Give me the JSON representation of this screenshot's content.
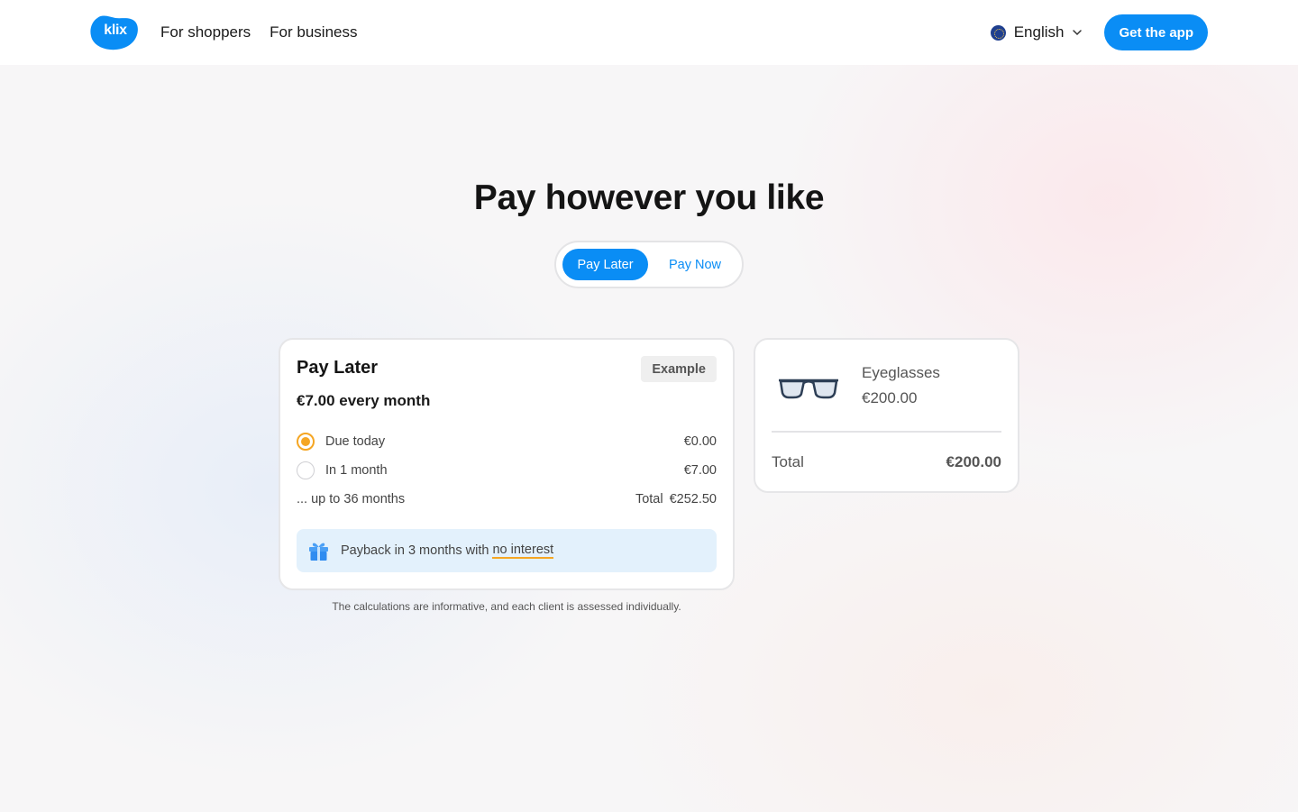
{
  "header": {
    "logo_text": "klix",
    "nav": [
      "For shoppers",
      "For business"
    ],
    "language": "English",
    "cta": "Get the app"
  },
  "main": {
    "title": "Pay however you like",
    "tabs": [
      "Pay Later",
      "Pay Now"
    ],
    "active_tab": "Pay Later"
  },
  "plan_card": {
    "title": "Pay Later",
    "badge": "Example",
    "monthly": "€7.00 every month",
    "schedule": [
      {
        "label": "Due today",
        "amount": "€0.00",
        "selected": true
      },
      {
        "label": "In 1 month",
        "amount": "€7.00",
        "selected": false
      }
    ],
    "upto_label": "... up to 36 months",
    "total_label": "Total",
    "total_value": "€252.50",
    "promo_text": "Payback in 3 months with ",
    "promo_highlight": "no interest",
    "disclaimer": "The calculations are informative, and each client is assessed individually."
  },
  "cart_card": {
    "product_name": "Eyeglasses",
    "product_price": "€200.00",
    "total_label": "Total",
    "total_value": "€200.00"
  },
  "colors": {
    "accent": "#0a8df5",
    "highlight": "#f5a623",
    "promo_bg": "#e3f1fc"
  },
  "icons": [
    "globe-icon",
    "chevron-down-icon",
    "gift-icon",
    "eyeglasses-icon"
  ]
}
